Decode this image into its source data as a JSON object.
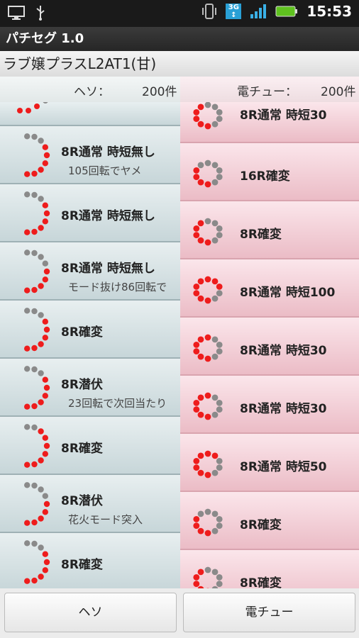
{
  "status": {
    "time": "15:53",
    "network": "3G",
    "icons": [
      "monitor-icon",
      "usb-icon",
      "vibrate-icon",
      "3g-icon",
      "signal-icon",
      "battery-icon"
    ]
  },
  "app": {
    "title": "パチセグ 1.0"
  },
  "machine": {
    "name": "ラブ嬢プラスL2AT1(甘)"
  },
  "counts": {
    "left": {
      "label": "ヘソ：",
      "value": "200件"
    },
    "right": {
      "label": "電チュー：",
      "value": "200件"
    }
  },
  "left_list": [
    {
      "title": "",
      "sub": ""
    },
    {
      "title": "8R通常 時短無し",
      "sub": "105回転でヤメ"
    },
    {
      "title": "8R通常 時短無し",
      "sub": ""
    },
    {
      "title": "8R通常 時短無し",
      "sub": "モード抜け86回転で"
    },
    {
      "title": "8R確変",
      "sub": ""
    },
    {
      "title": "8R潜伏",
      "sub": "23回転で次回当たり"
    },
    {
      "title": "8R確変",
      "sub": ""
    },
    {
      "title": "8R潜伏",
      "sub": "花火モード突入"
    },
    {
      "title": "8R確変",
      "sub": ""
    }
  ],
  "right_list": [
    {
      "title": "8R通常 時短30"
    },
    {
      "title": "16R確変"
    },
    {
      "title": "8R確変"
    },
    {
      "title": "8R通常 時短100"
    },
    {
      "title": "8R通常 時短30"
    },
    {
      "title": "8R通常 時短30"
    },
    {
      "title": "8R通常 時短50"
    },
    {
      "title": "8R確変"
    },
    {
      "title": "8R確変"
    }
  ],
  "buttons": {
    "heso": "ヘソ",
    "denchu": "電チュー"
  },
  "colors": {
    "red_dot": "#ee1c1c",
    "grey_dot": "#8a8a8a"
  }
}
